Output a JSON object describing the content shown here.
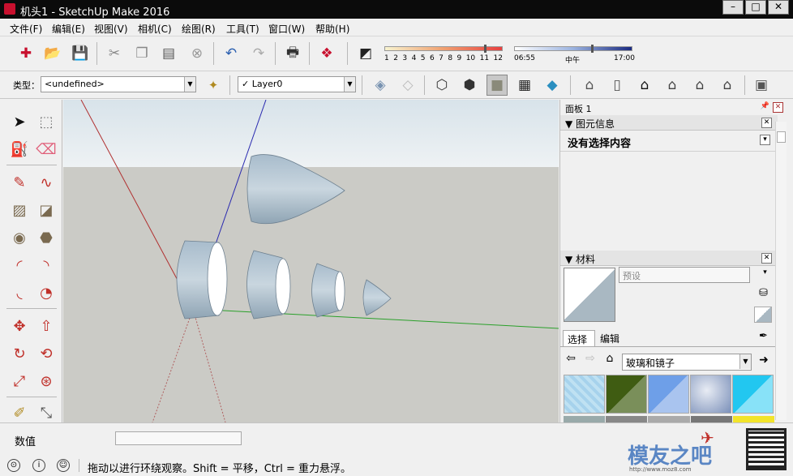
{
  "window": {
    "title": "机头1 - SketchUp Make 2016"
  },
  "menu": [
    "文件(F)",
    "编辑(E)",
    "视图(V)",
    "相机(C)",
    "绘图(R)",
    "工具(T)",
    "窗口(W)",
    "帮助(H)"
  ],
  "shadow_bar": {
    "months": [
      "1",
      "2",
      "3",
      "4",
      "5",
      "6",
      "7",
      "8",
      "9",
      "10",
      "11",
      "12"
    ],
    "time_start": "06:55",
    "time_mid": "中午",
    "time_end": "17:00"
  },
  "entity": {
    "type_label": "类型：",
    "type_value": "<undefined>",
    "layer_value": "Layer0"
  },
  "panel": {
    "title": "面板 1",
    "entity_info": {
      "header": "图元信息",
      "content": "没有选择内容"
    },
    "materials": {
      "header": "材料",
      "name_placeholder": "预设",
      "tab_select": "选择",
      "tab_edit": "编辑",
      "library": "玻璃和镜子",
      "swatch_colors": [
        "#bfe1f2",
        "#3f5c12",
        "#6e9fe8",
        "#9bb0d2",
        "#22c7f0"
      ]
    }
  },
  "status": {
    "measure_label": "数值",
    "hint": "拖动以进行环绕观察。Shift = 平移，Ctrl = 重力悬浮。"
  },
  "watermark": {
    "text": "模友之吧",
    "url": "http://www.moz8.com"
  },
  "icons": [
    "new-icon",
    "open-icon",
    "save-icon",
    "cut-icon",
    "copy-icon",
    "paste-icon",
    "erase-icon",
    "undo-icon",
    "redo-icon",
    "print-icon",
    "model-info-icon",
    "shadow-icon"
  ]
}
